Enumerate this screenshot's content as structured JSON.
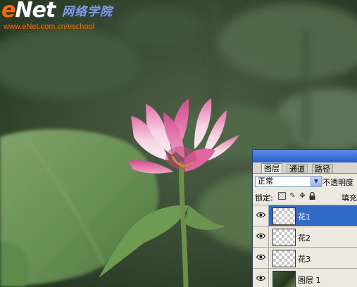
{
  "watermark": {
    "logo_e": "e",
    "logo_net": "Net",
    "logo_chinese": "网络学院",
    "url": "www.eNet.com.cn/eschool"
  },
  "colors": {
    "brand_orange": "#ff6a00",
    "panel_bg": "#ece9e0",
    "selection_blue": "#3169c6"
  },
  "layers_panel": {
    "tabs": [
      {
        "label": "图层",
        "active": true
      },
      {
        "label": "通道",
        "active": false
      },
      {
        "label": "路径",
        "active": false
      }
    ],
    "blend_mode": "正常",
    "opacity_label": "不透明度",
    "lock_label": "锁定:",
    "lock_icons": [
      "transparency-lock-icon",
      "brush-lock-icon",
      "move-lock-icon",
      "padlock-icon"
    ],
    "fill_label": "填充",
    "layers": [
      {
        "name": "花1",
        "selected": true,
        "visible": true,
        "thumbnail": "transparent-checkerboard"
      },
      {
        "name": "花2",
        "selected": false,
        "visible": true,
        "thumbnail": "transparent-checkerboard"
      },
      {
        "name": "花3",
        "selected": false,
        "visible": true,
        "thumbnail": "transparent-checkerboard"
      },
      {
        "name": "图层 1",
        "selected": false,
        "visible": true,
        "thumbnail": "photo"
      }
    ]
  }
}
